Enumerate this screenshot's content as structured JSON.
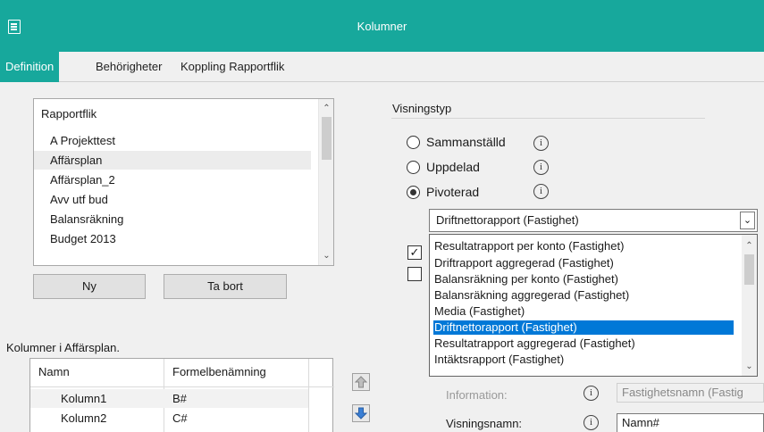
{
  "window": {
    "title": "Kolumner"
  },
  "tabs": [
    {
      "label": "Definition"
    },
    {
      "label": "Behörigheter"
    },
    {
      "label": "Koppling Rapportflik"
    }
  ],
  "rapportflik": {
    "header": "Rapportflik",
    "items": [
      "A Projekttest",
      "Affärsplan",
      "Affärsplan_2",
      "Avv utf bud",
      "Balansräkning",
      "Budget 2013"
    ]
  },
  "buttons": {
    "new": "Ny",
    "delete": "Ta bort"
  },
  "kolumner": {
    "caption": "Kolumner i Affärsplan.",
    "columns": [
      "Namn",
      "Formelbenämning"
    ],
    "rows": [
      {
        "namn": "Kolumn1",
        "formel": "B#"
      },
      {
        "namn": "Kolumn2",
        "formel": "C#"
      }
    ]
  },
  "visningstyp": {
    "group_label": "Visningstyp",
    "options": [
      {
        "label": "Sammanställd",
        "selected": false
      },
      {
        "label": "Uppdelad",
        "selected": false
      },
      {
        "label": "Pivoterad",
        "selected": true
      }
    ]
  },
  "report_combo": {
    "value": "Driftnettorapport (Fastighet)",
    "options": [
      "Resultatrapport per konto (Fastighet)",
      "Driftrapport aggregerad (Fastighet)",
      "Balansräkning per konto (Fastighet)",
      "Balansräkning aggregerad (Fastighet)",
      "Media (Fastighet)",
      "Driftnettorapport (Fastighet)",
      "Resultatrapport aggregerad (Fastighet)",
      "Intäktsrapport (Fastighet)"
    ],
    "highlighted_index": 5
  },
  "checkboxes": [
    {
      "checked": true
    },
    {
      "checked": false
    }
  ],
  "fields": {
    "information_label": "Information:",
    "information_value": "Fastighetsnamn (Fastig",
    "visningsnamn_label": "Visningsnamn:",
    "visningsnamn_value": "Namn#"
  },
  "colors": {
    "accent": "#17a89c",
    "selection": "#0078d7"
  },
  "icons": [
    "window-icon",
    "info-icon",
    "chevron-up-icon",
    "chevron-down-icon",
    "arrow-up-icon",
    "arrow-down-icon"
  ]
}
